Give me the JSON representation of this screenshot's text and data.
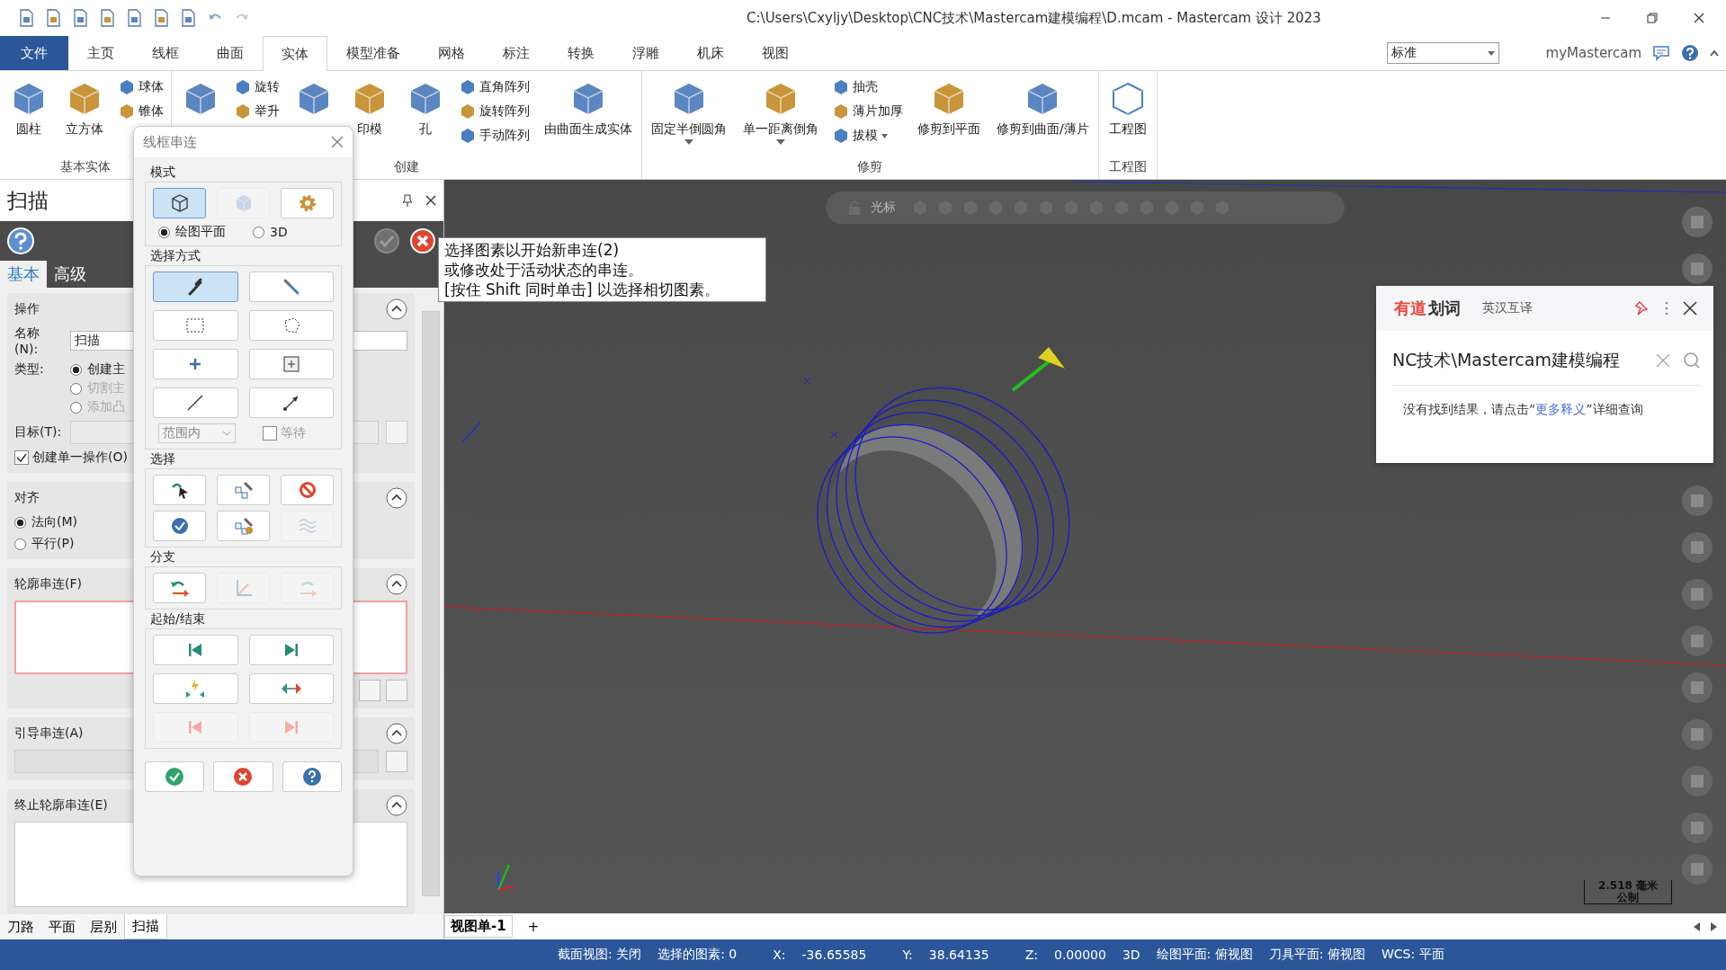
{
  "title_bar": {
    "title": "C:\\Users\\Cxyljy\\Desktop\\CNC技术\\Mastercam建模编程\\D.mcam - Mastercam 设计 2023"
  },
  "menu_tabs": [
    {
      "label": "文件",
      "kind": "file"
    },
    {
      "label": "主页",
      "kind": "tab",
      "selected": false
    },
    {
      "label": "线框",
      "kind": "tab",
      "selected": false
    },
    {
      "label": "曲面",
      "kind": "tab",
      "selected": false
    },
    {
      "label": "实体",
      "kind": "tab",
      "selected": true
    },
    {
      "label": "模型准备",
      "kind": "tab",
      "selected": false
    },
    {
      "label": "网格",
      "kind": "tab",
      "selected": false
    },
    {
      "label": "标注",
      "kind": "tab",
      "selected": false
    },
    {
      "label": "转换",
      "kind": "tab",
      "selected": false
    },
    {
      "label": "浮雕",
      "kind": "tab",
      "selected": false
    },
    {
      "label": "机床",
      "kind": "tab",
      "selected": false
    },
    {
      "label": "视图",
      "kind": "tab",
      "selected": false
    }
  ],
  "preset_select": {
    "value": "标准"
  },
  "account": "myMastercam",
  "ribbon_groups": [
    {
      "label": "基本实体",
      "columns": [
        {
          "kind": "large",
          "label": "圆柱"
        },
        {
          "kind": "large",
          "label": "立方体"
        },
        {
          "kind": "stack",
          "items": [
            {
              "label": "球体"
            },
            {
              "label": "锥体"
            }
          ]
        }
      ]
    },
    {
      "label": "创建",
      "columns": [
        {
          "kind": "large"
        },
        {
          "kind": "stack",
          "items": [
            {
              "label": "旋转"
            },
            {
              "label": "举升"
            }
          ]
        },
        {
          "kind": "large"
        },
        {
          "kind": "large",
          "label": "印模"
        },
        {
          "kind": "large",
          "label": "孔"
        },
        {
          "kind": "stack",
          "items": [
            {
              "label": "直角阵列"
            },
            {
              "label": "旋转阵列"
            },
            {
              "label": "手动阵列"
            }
          ]
        },
        {
          "kind": "large",
          "label": "由曲面生成实体"
        }
      ]
    },
    {
      "label": "修剪",
      "columns": [
        {
          "kind": "large",
          "label": "固定半倒圆角",
          "dropdown": true
        },
        {
          "kind": "large",
          "label": "单一距离倒角",
          "dropdown": true
        },
        {
          "kind": "stack",
          "items": [
            {
              "label": "抽壳"
            },
            {
              "label": "薄片加厚"
            },
            {
              "label": "拔模",
              "dropdown": true
            }
          ]
        },
        {
          "kind": "large",
          "label": "修剪到平面"
        },
        {
          "kind": "large",
          "label": "修剪到曲面/薄片"
        }
      ]
    },
    {
      "label": "工程图",
      "columns": [
        {
          "kind": "large",
          "label": "工程图"
        }
      ]
    }
  ],
  "side_panel": {
    "title": "扫描",
    "tabs": [
      {
        "label": "基本",
        "selected": true
      },
      {
        "label": "高级",
        "selected": false
      }
    ],
    "operation": {
      "heading": "操作",
      "name_label": "名称(N):",
      "name_value": "扫描",
      "type_label": "类型:",
      "types": [
        {
          "label": "创建主",
          "selected": true,
          "disabled": false
        },
        {
          "label": "切割主",
          "selected": false,
          "disabled": true
        },
        {
          "label": "添加凸",
          "selected": false,
          "disabled": true
        }
      ],
      "target_label": "目标(T):",
      "single_op": {
        "label": "创建单一操作(O)",
        "checked": true
      }
    },
    "align": {
      "heading": "对齐",
      "options": [
        {
          "label": "法向(M)",
          "selected": true
        },
        {
          "label": "平行(P)",
          "selected": false
        }
      ]
    },
    "profile_chain": {
      "heading": "轮廓串连(F)"
    },
    "guide_chain": {
      "heading": "引导串连(A)"
    },
    "end_chain": {
      "heading": "终止轮廓串连(E)"
    },
    "bottom_tabs": [
      {
        "label": "刀路",
        "selected": false
      },
      {
        "label": "平面",
        "selected": false
      },
      {
        "label": "层别",
        "selected": false
      },
      {
        "label": "扫描",
        "selected": true
      }
    ]
  },
  "chain_dialog": {
    "title": "线框串连",
    "groups": [
      {
        "heading": "模式",
        "buttons": [
          {
            "kind": "wire-cube",
            "selected": true,
            "disabled": false
          },
          {
            "kind": "solid-cube",
            "selected": false,
            "disabled": true
          },
          {
            "kind": "gear",
            "selected": false,
            "disabled": false
          }
        ]
      },
      {
        "heading": "选择方式",
        "buttons": [
          {
            "kind": "chain",
            "selected": true,
            "disabled": false
          },
          {
            "kind": "chain-blue",
            "selected": false,
            "disabled": false
          },
          {
            "kind": "window",
            "selected": false,
            "disabled": false
          },
          {
            "kind": "polygon",
            "selected": false,
            "disabled": false
          },
          {
            "kind": "plus",
            "selected": false,
            "disabled": false
          },
          {
            "kind": "boxed-plus",
            "selected": false,
            "disabled": false
          },
          {
            "kind": "line",
            "selected": false,
            "disabled": false
          },
          {
            "kind": "vector",
            "selected": false,
            "disabled": false
          }
        ]
      },
      {
        "heading": "选择",
        "buttons": [
          {
            "kind": "undo-pick",
            "selected": false,
            "disabled": false
          },
          {
            "kind": "chain-squares",
            "selected": false,
            "disabled": false
          },
          {
            "kind": "no-sign",
            "selected": false,
            "disabled": false
          },
          {
            "kind": "add-dot",
            "selected": false,
            "disabled": false
          },
          {
            "kind": "chain-gear",
            "selected": false,
            "disabled": false
          },
          {
            "kind": "waves",
            "selected": false,
            "disabled": true
          }
        ]
      },
      {
        "heading": "分支",
        "buttons": [
          {
            "kind": "back-arrow",
            "selected": false,
            "disabled": false
          },
          {
            "kind": "axes",
            "selected": false,
            "disabled": true
          },
          {
            "kind": "forward-arrow",
            "selected": false,
            "disabled": true
          }
        ]
      },
      {
        "heading": "起始/结束",
        "buttons": [
          {
            "kind": "to-start",
            "selected": false,
            "disabled": false
          },
          {
            "kind": "to-end",
            "selected": false,
            "disabled": false
          },
          {
            "kind": "flash",
            "selected": false,
            "disabled": false
          },
          {
            "kind": "swap",
            "selected": false,
            "disabled": false
          },
          {
            "kind": "to-start",
            "selected": false,
            "disabled": true
          },
          {
            "kind": "to-end",
            "selected": false,
            "disabled": true
          }
        ]
      }
    ],
    "mode_radios": [
      {
        "label": "绘图平面",
        "selected": true
      },
      {
        "label": "3D",
        "selected": false
      }
    ],
    "range_select": {
      "value": "范围内",
      "disabled": true
    },
    "wait_checkbox": {
      "label": "等待",
      "checked": false,
      "disabled": true
    }
  },
  "tooltip": {
    "lines": [
      "选择图素以开始新串连(2)",
      "或修改处于活动状态的串连。",
      "[按住 Shift 同时单击] 以选择相切图素。"
    ]
  },
  "viewport_toolbar": {
    "label": "光标"
  },
  "dictionary_popup": {
    "brand": "有道",
    "brand_suffix": "划词",
    "mode": "英汉互译",
    "query": "NC技术\\Mastercam建模编程",
    "message_before": "没有找到结果，请点击“",
    "link": "更多释义",
    "message_after": "”详细查询"
  },
  "scale": {
    "value": "2.518 毫米",
    "unit": "公制"
  },
  "view_tabs": [
    {
      "label": "视图单-1",
      "selected": true
    },
    {
      "label": "+",
      "selected": false
    }
  ],
  "status_bar": {
    "section_view": "截面视图: 关闭",
    "selected_count": "选择的图素: 0",
    "coordinates": [
      {
        "axis": "X:",
        "value": "-36.65585"
      },
      {
        "axis": "Y:",
        "value": "38.64135"
      },
      {
        "axis": "Z:",
        "value": "0.00000"
      }
    ],
    "items": [
      "3D",
      "绘图平面: 俯视图",
      "刀具平面: 俯视图",
      "WCS: 平面"
    ]
  }
}
